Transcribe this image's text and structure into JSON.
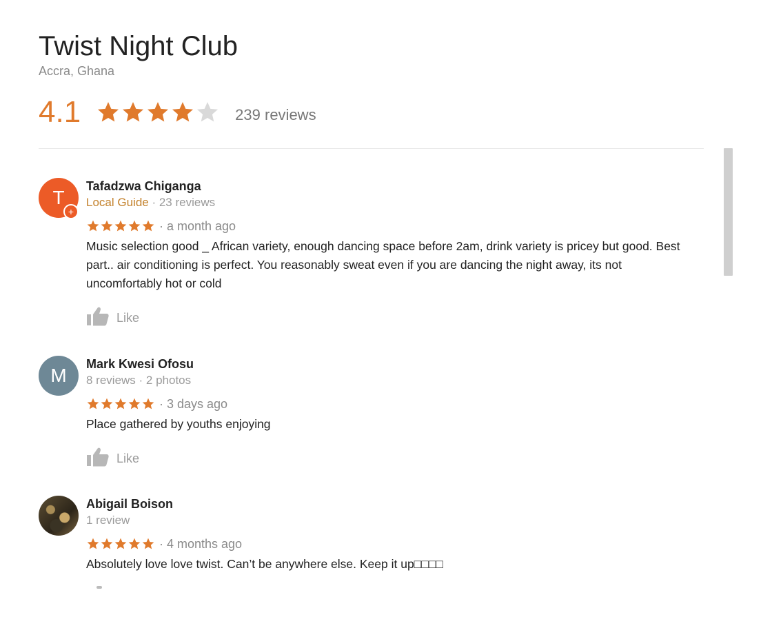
{
  "place": {
    "name": "Twist Night Club",
    "location": "Accra, Ghana",
    "rating": "4.1",
    "rating_value": 4.1,
    "rating_max": 5,
    "review_count": "239 reviews"
  },
  "colors": {
    "star": "#e07a2c",
    "star_empty": "#d9d9d9",
    "local_guide": "#c3812b"
  },
  "reviews": [
    {
      "name": "Tafadzwa Chiganga",
      "avatar_letter": "T",
      "local_guide": "Local Guide",
      "meta": " · 23 reviews",
      "stars": 5,
      "when": "· a month ago",
      "text": "Music selection good _ African variety, enough dancing space before 2am, drink variety is pricey but good. Best part.. air conditioning is perfect. You reasonably sweat even if you are dancing the night away,  its not uncomfortably hot or cold",
      "like_label": "Like",
      "icon": "thumbs-up-icon"
    },
    {
      "name": "Mark Kwesi Ofosu",
      "avatar_letter": "M",
      "meta": "8 reviews · 2 photos",
      "stars": 5,
      "when": "· 3 days ago",
      "text": "Place gathered by youths enjoying",
      "like_label": "Like",
      "icon": "thumbs-up-icon"
    },
    {
      "name": "Abigail Boison",
      "meta": "1 review",
      "stars": 5,
      "when": "· 4 months ago",
      "text": "Absolutely love love twist. Can’t be anywhere else. Keep it up□□□□",
      "icon": "avatar-photo"
    }
  ]
}
